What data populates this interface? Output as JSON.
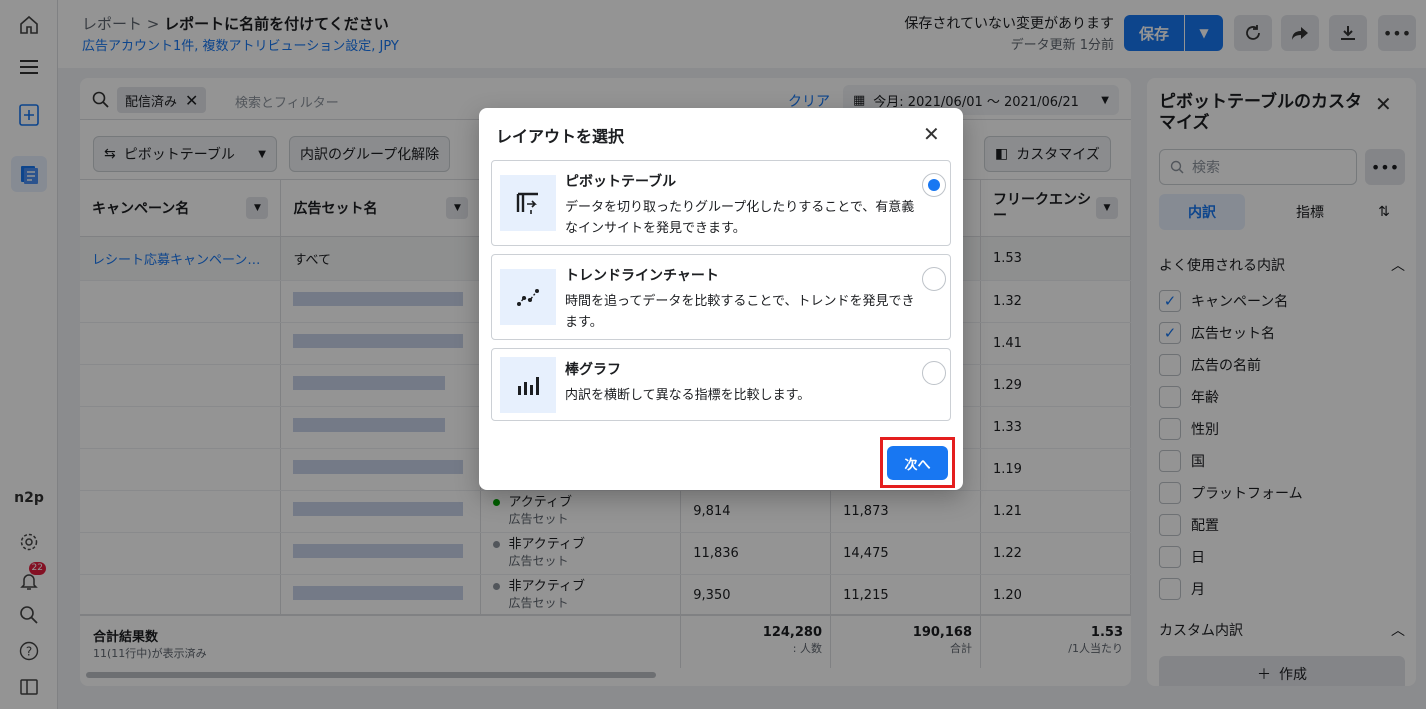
{
  "header": {
    "breadcrumb_root": "レポート",
    "breadcrumb_sep": ">",
    "report_title": "レポートに名前を付けてください",
    "subtitle": "広告アカウント1件, 複数アトリビューション設定, JPY",
    "unsaved": "保存されていない変更があります",
    "updated": "データ更新 1分前",
    "save_label": "保存"
  },
  "leftnav": {
    "badge_count": "22",
    "brand_text": "n2p"
  },
  "filter": {
    "chip_label": "配信済み",
    "placeholder": "検索とフィルター",
    "clear_label": "クリア",
    "date_range": "今月: 2021/06/01 ～ 2021/06/21"
  },
  "toolbar": {
    "pivot_label": "ピボットテーブル",
    "ungroup_label": "内訳のグループ化解除",
    "customize_label": "カスタマイズ"
  },
  "table": {
    "col_campaign": "キャンペーン名",
    "col_adset": "広告セット名",
    "col_frequency": "フリークエンシー",
    "campaign_name": "レシート応募キャンペーン…",
    "adset_all": "すべて",
    "freq_values": [
      "1.53",
      "1.32",
      "1.41",
      "1.29",
      "1.33",
      "1.19"
    ],
    "rows": [
      {
        "status": "アクティブ",
        "sub": "広告セット",
        "c1": "9,814",
        "c2": "11,873",
        "freq": "1.21",
        "color": "#00a400"
      },
      {
        "status": "非アクティブ",
        "sub": "広告セット",
        "c1": "11,836",
        "c2": "14,475",
        "freq": "1.22",
        "color": "#8d949e"
      },
      {
        "status": "非アクティブ",
        "sub": "広告セット",
        "c1": "9,350",
        "c2": "11,215",
        "freq": "1.20",
        "color": "#8d949e"
      }
    ],
    "footer": {
      "label": "合計結果数",
      "sub": "11(11行中)が表示済み",
      "v1": "124,280",
      "v1_sub": ": 人数",
      "v2": "190,168",
      "v2_sub": "合計",
      "v3": "1.53",
      "v3_sub": "/1人当たり"
    }
  },
  "rpanel": {
    "title": "ピボットテーブルのカスタマイズ",
    "search_placeholder": "検索",
    "tab_breakdown": "内訳",
    "tab_metrics": "指標",
    "section_common": "よく使用される内訳",
    "items": [
      {
        "label": "キャンペーン名",
        "checked": true
      },
      {
        "label": "広告セット名",
        "checked": true
      },
      {
        "label": "広告の名前",
        "checked": false
      },
      {
        "label": "年齢",
        "checked": false
      },
      {
        "label": "性別",
        "checked": false
      },
      {
        "label": "国",
        "checked": false
      },
      {
        "label": "プラットフォーム",
        "checked": false
      },
      {
        "label": "配置",
        "checked": false
      },
      {
        "label": "日",
        "checked": false
      },
      {
        "label": "月",
        "checked": false
      }
    ],
    "section_custom": "カスタム内訳",
    "create_label": "作成"
  },
  "modal": {
    "title": "レイアウトを選択",
    "options": [
      {
        "name": "ピボットテーブル",
        "desc": "データを切り取ったりグループ化したりすることで、有意義なインサイトを発見できます。",
        "selected": true
      },
      {
        "name": "トレンドラインチャート",
        "desc": "時間を追ってデータを比較することで、トレンドを発見できます。",
        "selected": false
      },
      {
        "name": "棒グラフ",
        "desc": "内訳を横断して異なる指標を比較します。",
        "selected": false
      }
    ],
    "next_label": "次へ"
  }
}
